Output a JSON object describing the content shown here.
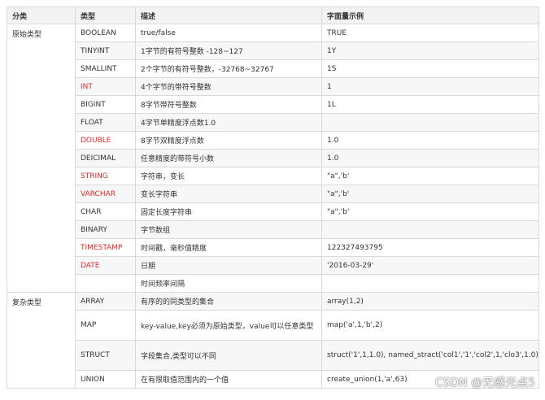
{
  "header": [
    "分类",
    "类型",
    "描述",
    "字面量示例"
  ],
  "groups": [
    "原始类型",
    "复杂类型"
  ],
  "rows": [
    {
      "type": "BOOLEAN",
      "desc": "true/false",
      "example": "TRUE"
    },
    {
      "type": "TINYINT",
      "desc": "1字节的有符号整数 -128~127",
      "example": "1Y"
    },
    {
      "type": "SMALLINT",
      "desc": "2个字节的有符号整数，-32768~32767",
      "example": "1S"
    },
    {
      "type": "INT",
      "desc": "4个字节的带符号整数",
      "example": "1"
    },
    {
      "type": "BIGINT",
      "desc": "8字节带符号整数",
      "example": "1L"
    },
    {
      "type": "FLOAT",
      "desc": "4字节单精度浮点数1.0",
      "example": ""
    },
    {
      "type": "DOUBLE",
      "desc": "8字节双精度浮点数",
      "example": "1.0"
    },
    {
      "type": "DEICIMAL",
      "desc": "任意精度的带符号小数",
      "example": "1.0"
    },
    {
      "type": "STRING",
      "desc": "字符串，变长",
      "example": "\"a\",'b'"
    },
    {
      "type": "VARCHAR",
      "desc": "变长字符串",
      "example": "\"a\",'b'"
    },
    {
      "type": "CHAR",
      "desc": "固定长度字符串",
      "example": "\"a\",'b'"
    },
    {
      "type": "BINARY",
      "desc": "字节数组",
      "example": ""
    },
    {
      "type": "TIMESTAMP",
      "desc": "时间戳，毫秒值精度",
      "example": "122327493795"
    },
    {
      "type": "DATE",
      "desc": "日期",
      "example": "'2016-03-29'"
    },
    {
      "type": "",
      "desc": "时间频率间隔",
      "example": ""
    },
    {
      "type": "ARRAY",
      "desc": "有序的的同类型的集合",
      "example": "array(1,2)"
    },
    {
      "type": "MAP",
      "desc": "key-value,key必须为原始类型，value可以任意类型",
      "example": "map('a',1,'b',2)"
    },
    {
      "type": "STRUCT",
      "desc": "字段集合,类型可以不同",
      "example": "struct('1',1,1.0), named_stract('col1','1','col2',1,'clo3',1.0)"
    },
    {
      "type": "UNION",
      "desc": "在有限取值范围内的一个值",
      "example": "create_union(1,'a',63)"
    }
  ],
  "highlight_color": "#e02a2a",
  "watermark": "CSDN @无感光点5"
}
